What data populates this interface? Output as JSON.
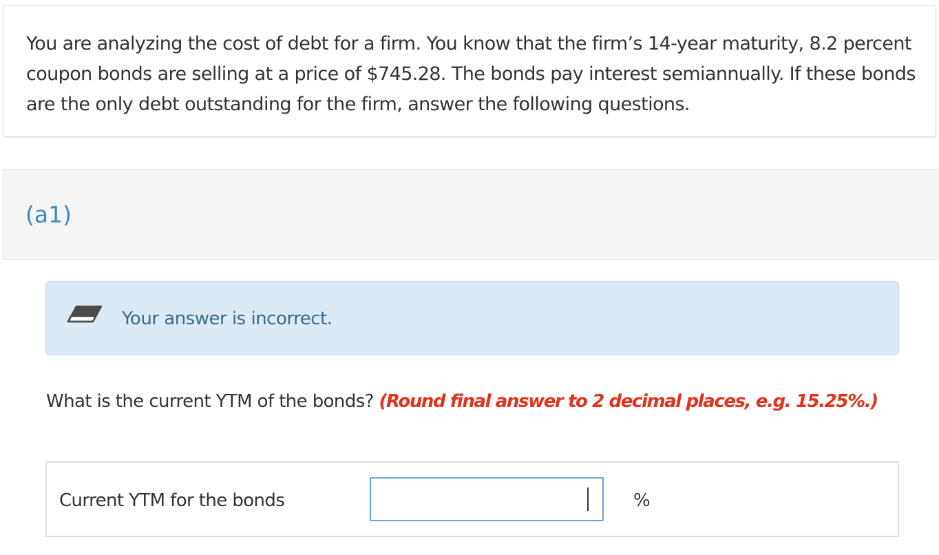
{
  "question": {
    "text": "You are analyzing the cost of debt for a firm. You know that the firm’s 14-year maturity, 8.2 percent coupon bonds are selling at a price of $745.28. The bonds pay interest semiannually. If these bonds are the only debt outstanding for the firm, answer the following questions."
  },
  "part": {
    "label": "(a1)"
  },
  "feedback": {
    "icon": "eraser-icon",
    "text": "Your answer is incorrect."
  },
  "prompt": {
    "question": "What is the current YTM of the bonds?",
    "instruction": "(Round final answer to 2 decimal places, e.g. 15.25%.)"
  },
  "answer": {
    "label": "Current YTM for the bonds",
    "value": "",
    "unit": "%"
  },
  "colors": {
    "part_label": "#3a86c8",
    "feedback_bg": "#dceaf6",
    "feedback_text": "#3d6b8e",
    "instruction": "#e0321c",
    "input_border": "#6aa3d8"
  }
}
